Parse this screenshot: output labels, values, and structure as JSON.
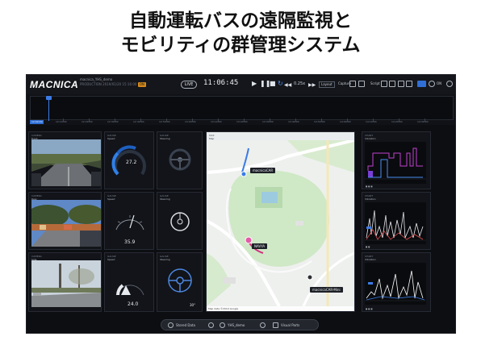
{
  "headline": {
    "line1": "自動運転バスの遠隔監視と",
    "line2": "モビリティの群管理システム"
  },
  "app": {
    "logo": "MACNICA",
    "project_name": "macnica_YHS_demo",
    "project_sub": "PRODUCTION 2019/01/20 15:16:00",
    "live_label": "LIVE",
    "clock": "11:06:45",
    "speed": "0.25x",
    "layout_select": "Layout",
    "capture_label": "Capture",
    "record_label": "Script",
    "mode_label": "ON"
  },
  "timeline": {
    "start_label": "12:00:00",
    "ticks": [
      "12:10:00",
      "12:20:00",
      "12:30:00",
      "12:40:00",
      "12:50:00",
      "13:00:00",
      "13:10:00",
      "13:20:00",
      "13:30:00",
      "13:40:00",
      "13:50:00",
      "14:00:00",
      "14:10:00",
      "14:20:00",
      "14:30:00"
    ]
  },
  "cameras": [
    {
      "title": "CAMERA",
      "name": "Front"
    },
    {
      "title": "CAMERA",
      "name": "Rear"
    },
    {
      "title": "CAMERA",
      "name": "Side"
    }
  ],
  "gauges": [
    {
      "title": "GAUGE",
      "name": "Speed",
      "value": "27.2"
    },
    {
      "title": "GAUGE",
      "name": "Speed",
      "value": "35.9"
    },
    {
      "title": "GAUGE",
      "name": "Speed",
      "value": "24.0"
    }
  ],
  "wheels": [
    {
      "title": "GAUGE",
      "name": "Steering",
      "value": "0°"
    },
    {
      "title": "GAUGE",
      "name": "Steering",
      "value": "0°"
    },
    {
      "title": "GAUGE",
      "name": "Steering",
      "value": "30°"
    }
  ],
  "map": {
    "title": "MAP",
    "sub": "Map",
    "labels": {
      "car1": "macnicaCAR",
      "navya": "NAVYA",
      "mini": "macnicaCAR-Mini"
    },
    "footer": "Map data ©2019 Google"
  },
  "charts": [
    {
      "title": "CHART",
      "name": "Vibration"
    },
    {
      "title": "CHART",
      "name": "Vibration"
    },
    {
      "title": "CHART",
      "name": "Vibration"
    }
  ],
  "bottombar": {
    "item1": "Stored Data",
    "item2": "YHS_demo",
    "item3": "Visual Parts"
  },
  "colors": {
    "accent": "#2f6fd6",
    "magenta": "#c040d0",
    "purple": "#7a3fd8"
  }
}
